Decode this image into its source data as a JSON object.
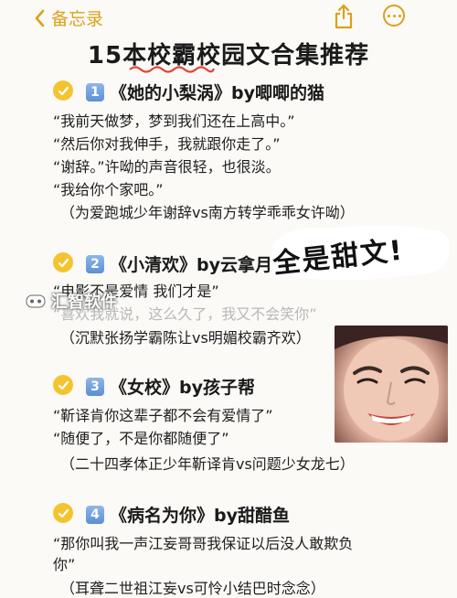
{
  "nav": {
    "back_label": "备忘录"
  },
  "title": "15本校霸校园文合集推荐",
  "items": [
    {
      "num": "1",
      "heading": "《她的小梨涡》by唧唧的猫",
      "lines": [
        "“我前天做梦，梦到我们还在上高中。”",
        "“然后你对我伸手，我就跟你走了。”",
        "“谢辞。”许呦的声音很轻，也很淡。",
        "“我给你个家吧。”"
      ],
      "note": "（为爱跑城少年谢辞vs南方转学乖乖女许呦）"
    },
    {
      "num": "2",
      "heading": "《小清欢》by云拿月",
      "lines": [
        "“电影不是爱情 我们才是”",
        "“喜欢我就说，这么久了，我又不会笑你”"
      ],
      "note": "（沉默张扬学霸陈让vs明媚校霸齐欢）"
    },
    {
      "num": "3",
      "heading": "《女校》by孩子帮",
      "lines": [
        "“靳译肯你这辈子都不会有爱情了”",
        "“随便了，不是你都随便了”"
      ],
      "note": "（二十四孝体正少年靳译肯vs问题少女龙七）"
    },
    {
      "num": "4",
      "heading": "《病名为你》by甜醋鱼",
      "lines": [
        "“那你叫我一声江妄哥哥我保证以后没人敢欺负",
        "你”"
      ],
      "note": "（耳聋二世祖江妄vs可怜小结巴时念念）"
    }
  ],
  "sticker": {
    "text": "全是甜文!"
  },
  "watermark": {
    "text": "汇智软件"
  },
  "colors": {
    "accent": "#d9a21b",
    "check": "#f4c430",
    "squiggle": "#e0463a"
  }
}
